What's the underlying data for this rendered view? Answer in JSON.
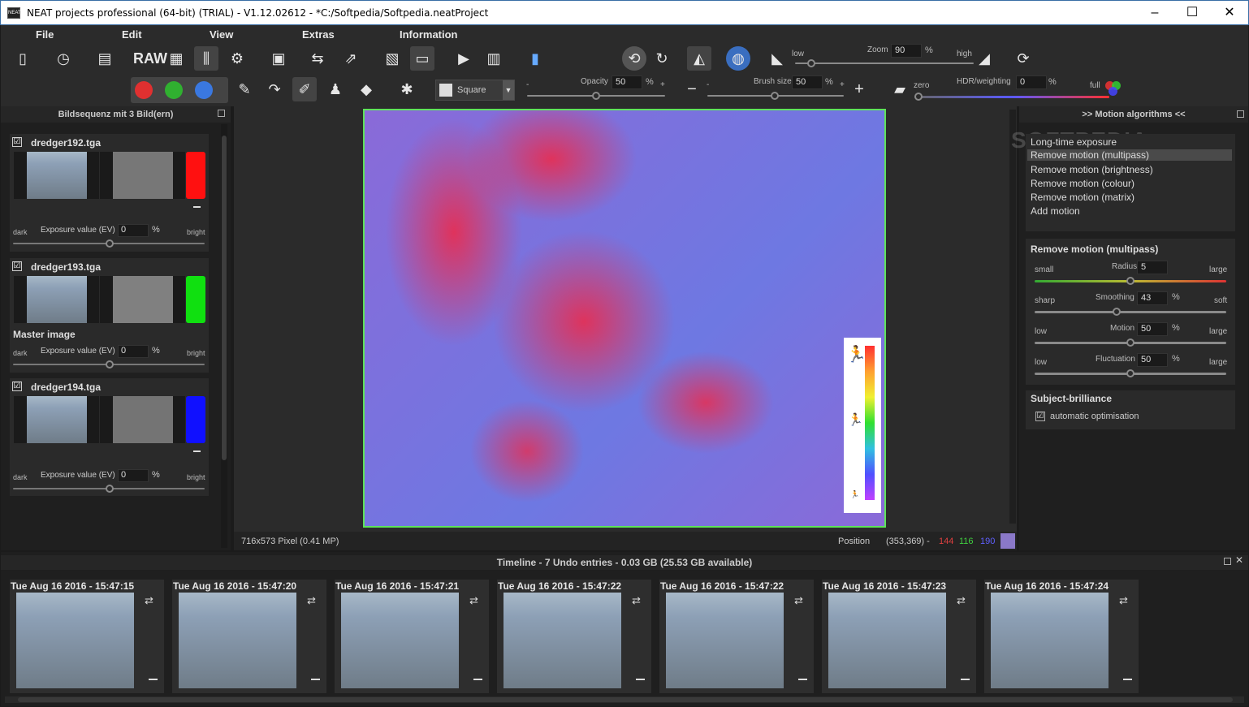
{
  "window": {
    "title": "NEAT projects professional (64-bit) (TRIAL) - V1.12.02612 - *C:/Softpedia/Softpedia.neatProject",
    "app_icon": "NEAT",
    "minimize": "–",
    "maximize": "☐",
    "close": "✕"
  },
  "menu": {
    "file": "File",
    "edit": "Edit",
    "view": "View",
    "extras": "Extras",
    "information": "Information"
  },
  "toolbar": {
    "raw": "RAW",
    "zoom": {
      "low": "low",
      "label": "Zoom",
      "value": "90",
      "unit": "%",
      "high": "high",
      "level": 90
    },
    "brush_shape": "Square",
    "opacity": {
      "label": "Opacity",
      "value": "50",
      "unit": "%",
      "minus": "-",
      "plus": "+",
      "level": 50
    },
    "brush_size": {
      "label": "Brush size",
      "value": "50",
      "unit": "%",
      "minus": "-",
      "plus": "+",
      "level": 50
    },
    "hdr": {
      "zero": "zero",
      "label": "HDR/weighting",
      "value": "0",
      "unit": "%",
      "full": "full",
      "level": 0
    },
    "colors": [
      "#e03030",
      "#30b030",
      "#3a78e0"
    ]
  },
  "left": {
    "title": "Bildsequenz mit 3 Bild(ern)",
    "items": [
      {
        "name": "dredger192.tga",
        "color": "#ff1010",
        "checked": "☑",
        "dark": "dark",
        "ev_label": "Exposure value (EV)",
        "ev": "0",
        "unit": "%",
        "bright": "bright",
        "master": ""
      },
      {
        "name": "dredger193.tga",
        "color": "#10e010",
        "checked": "☑",
        "dark": "dark",
        "ev_label": "Exposure value (EV)",
        "ev": "0",
        "unit": "%",
        "bright": "bright",
        "master": "Master image"
      },
      {
        "name": "dredger194.tga",
        "color": "#1010ff",
        "checked": "☑",
        "dark": "dark",
        "ev_label": "Exposure value (EV)",
        "ev": "0",
        "unit": "%",
        "bright": "bright",
        "master": ""
      }
    ]
  },
  "center": {
    "size": "716x573 Pixel (0.41 MP)",
    "position_label": "Position",
    "position": "(353,369) -",
    "r": "144",
    "g": "116",
    "b": "190",
    "swatch": "#8a78c8"
  },
  "right": {
    "title": ">> Motion algorithms <<",
    "watermark": "SOFTPEDIA",
    "algorithms": [
      "Long-time exposure",
      "Remove motion (multipass)",
      "Remove motion (brightness)",
      "Remove motion (colour)",
      "Remove motion (matrix)",
      "Add motion"
    ],
    "section": "Remove motion (multipass)",
    "radius": {
      "left": "small",
      "label": "Radius",
      "value": "5",
      "right": "large",
      "level": 0.5
    },
    "smoothing": {
      "left": "sharp",
      "label": "Smoothing",
      "value": "43",
      "unit": "%",
      "right": "soft",
      "level": 0.43
    },
    "motion": {
      "left": "low",
      "label": "Motion",
      "value": "50",
      "unit": "%",
      "right": "large",
      "level": 0.5
    },
    "fluctuation": {
      "left": "low",
      "label": "Fluctuation",
      "value": "50",
      "unit": "%",
      "right": "large",
      "level": 0.5
    },
    "brilliance": "Subject-brilliance",
    "auto_opt": "automatic optimisation",
    "auto_check": "☑"
  },
  "timeline": {
    "title": "Timeline - 7 Undo entries - 0.03 GB (25.53 GB available)",
    "entries": [
      "Tue Aug 16 2016 - 15:47:15",
      "Tue Aug 16 2016 - 15:47:20",
      "Tue Aug 16 2016 - 15:47:21",
      "Tue Aug 16 2016 - 15:47:22",
      "Tue Aug 16 2016 - 15:47:22",
      "Tue Aug 16 2016 - 15:47:23",
      "Tue Aug 16 2016 - 15:47:24"
    ]
  }
}
